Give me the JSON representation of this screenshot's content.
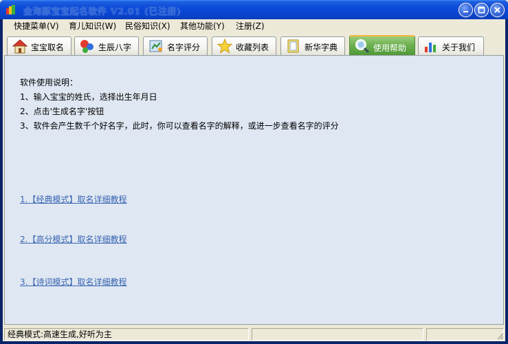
{
  "window": {
    "title": "金海豚宝宝起名软件 V2.01 (已注册)"
  },
  "menu": {
    "items": [
      {
        "label": "快捷菜单(V)"
      },
      {
        "label": "育儿知识(W)"
      },
      {
        "label": "民俗知识(X)"
      },
      {
        "label": "其他功能(Y)"
      },
      {
        "label": "注册(Z)"
      }
    ]
  },
  "tabs": [
    {
      "label": "宝宝取名",
      "icon": "house-icon"
    },
    {
      "label": "生辰八字",
      "icon": "balls-icon"
    },
    {
      "label": "名字评分",
      "icon": "rating-icon"
    },
    {
      "label": "收藏列表",
      "icon": "star-icon"
    },
    {
      "label": "新华字典",
      "icon": "dictionary-icon"
    },
    {
      "label": "使用帮助",
      "icon": "magnifier-icon",
      "active": true
    },
    {
      "label": "关于我们",
      "icon": "chart-icon"
    }
  ],
  "help": {
    "heading": "软件使用说明：",
    "steps": [
      "1、输入宝宝的姓氏，选择出生年月日",
      "2、点击'生成名字'按钮",
      "3、软件会产生数千个好名字，此时，你可以查看名字的解释，或进一步查看名字的评分"
    ],
    "links": [
      "1.【经典模式】取名详细教程",
      "2.【高分模式】取名详细教程",
      "3.【诗词模式】取名详细教程"
    ]
  },
  "status": {
    "mode_text": "经典模式:高速生成,好听为主",
    "pane2": "",
    "pane3": ""
  },
  "colors": {
    "titlebar": "#0A45D0",
    "active_tab": "#6DB050",
    "panel_bg": "#DFE7F2",
    "link": "#3A66B2"
  }
}
